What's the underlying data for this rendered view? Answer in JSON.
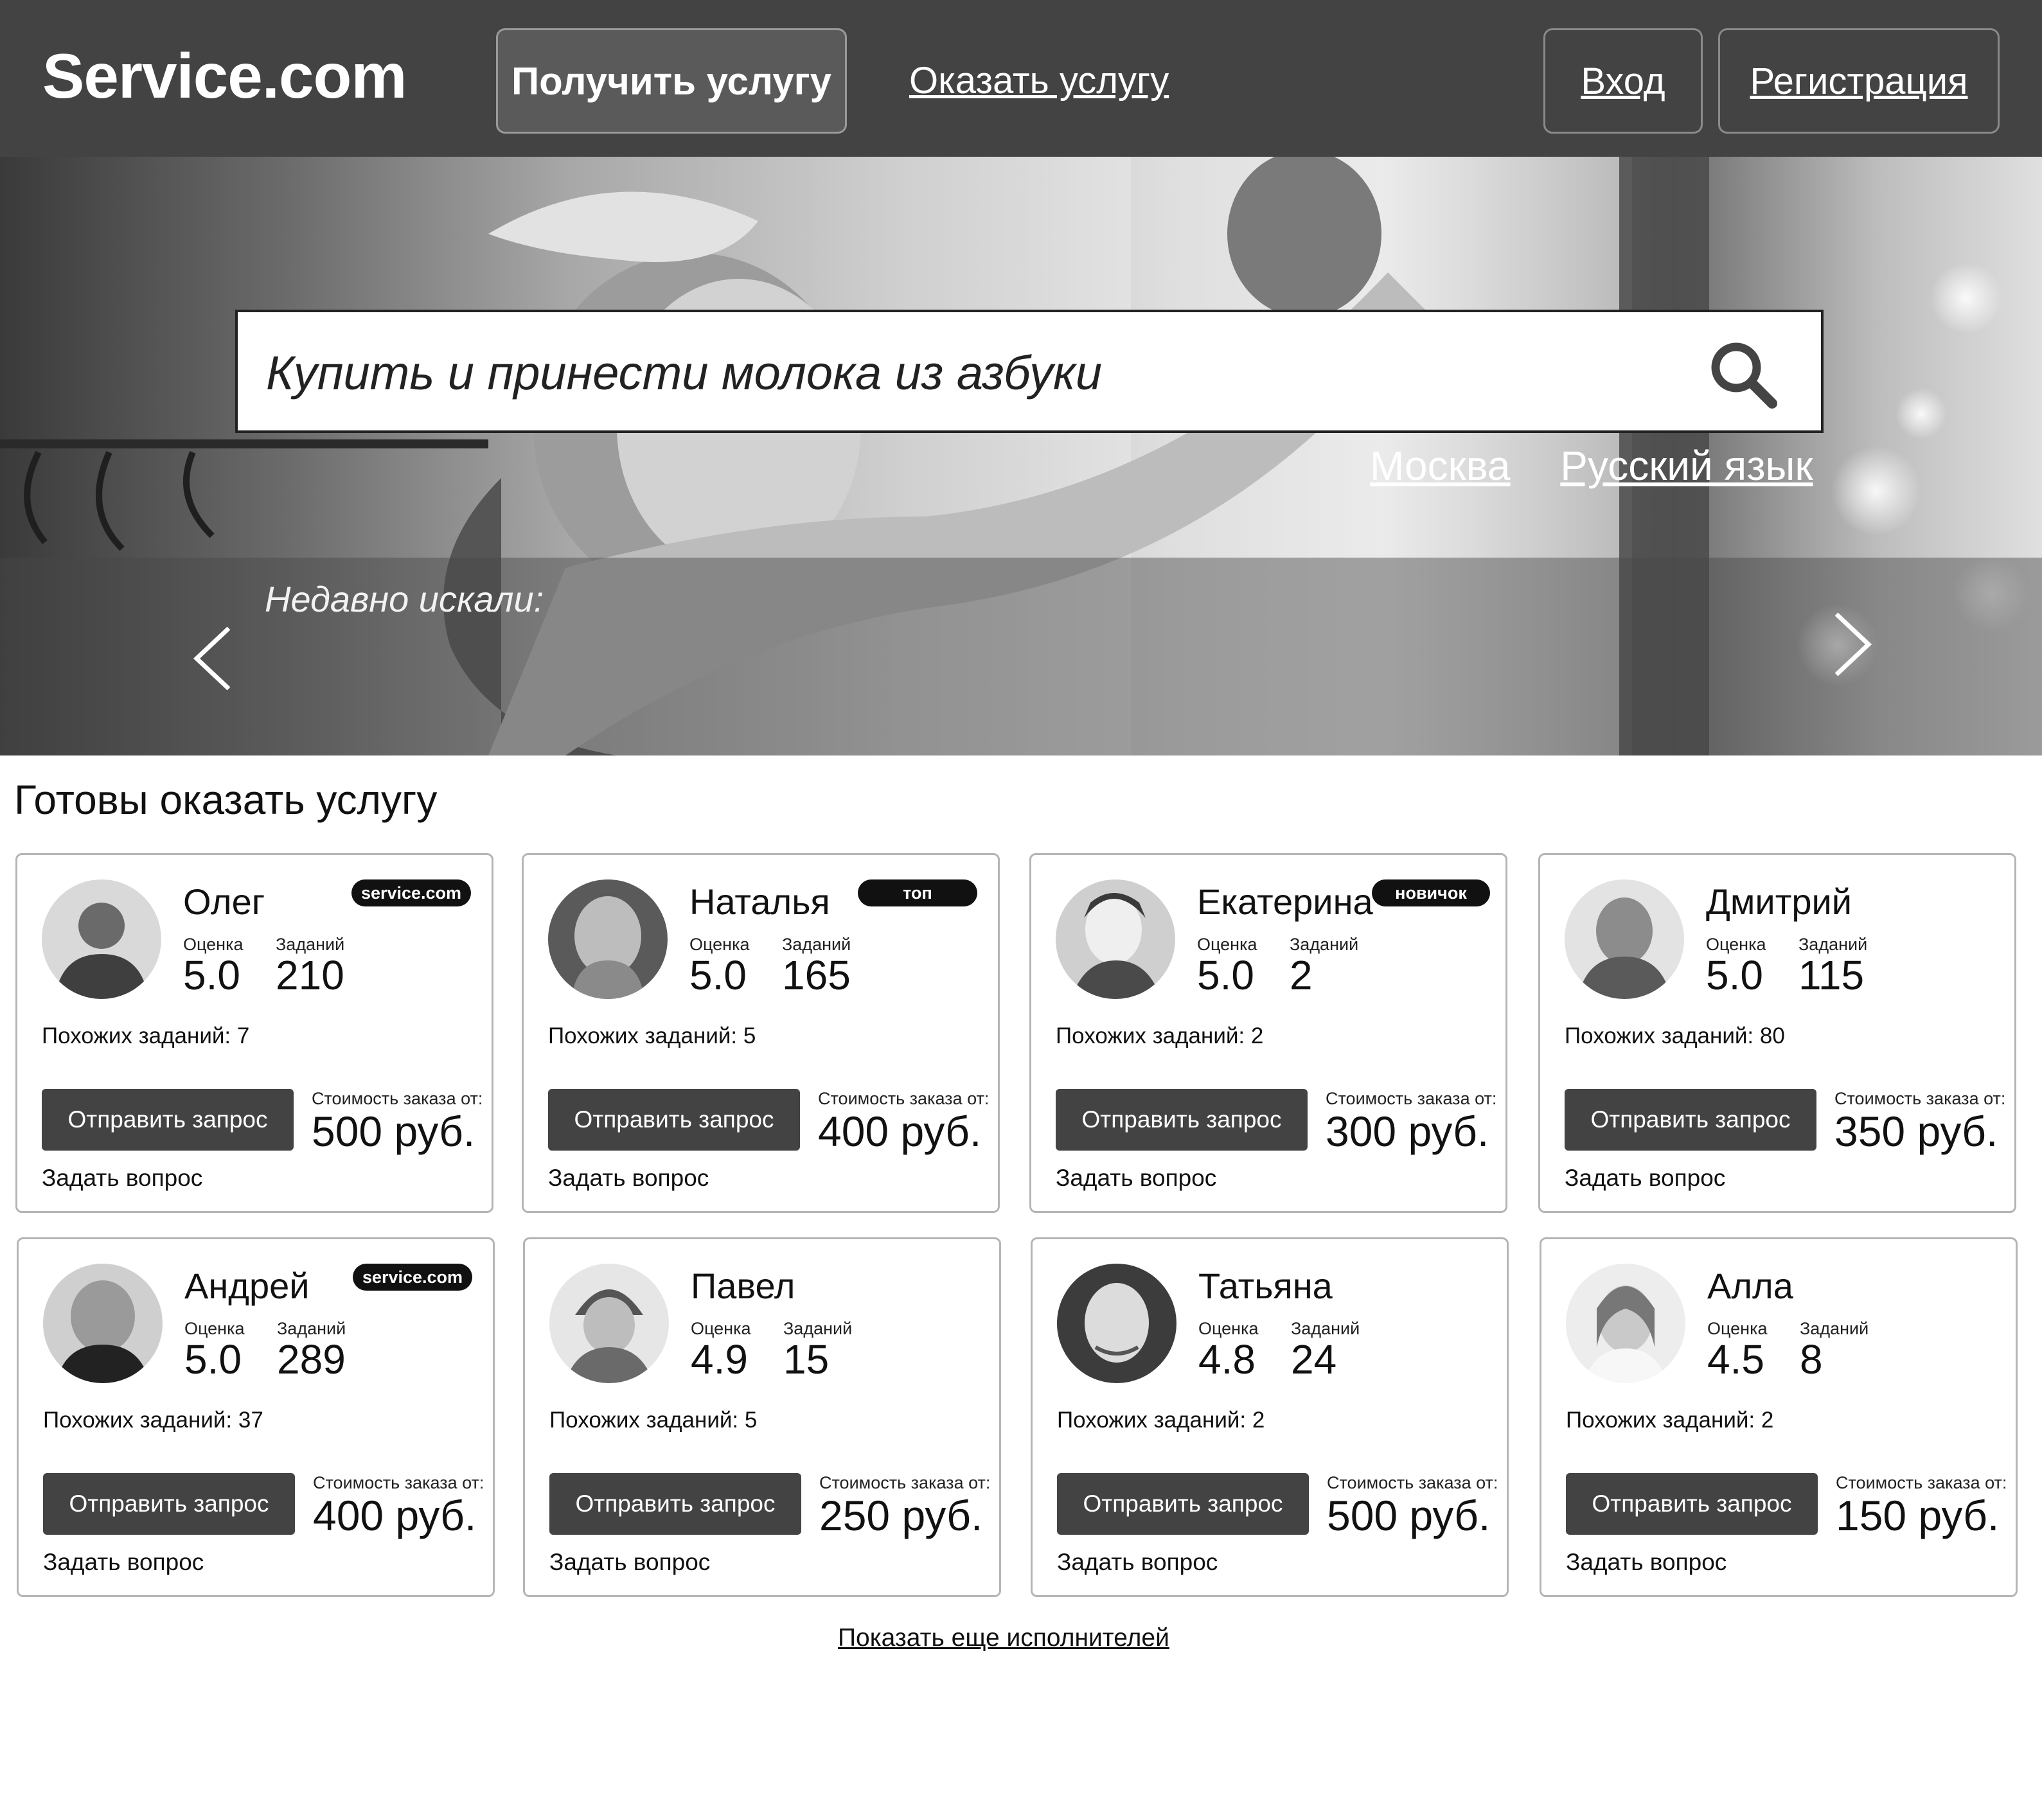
{
  "header": {
    "logo": "Service.com",
    "get_service": "Получить услугу",
    "offer_service": "Оказать услугу",
    "login": "Вход",
    "register": "Регистрация"
  },
  "hero": {
    "search_value": "Купить и принести молока из азбуки",
    "city": "Москва",
    "language": "Русский язык",
    "recent_label": "Недавно искали:"
  },
  "section": {
    "title": "Готовы оказать услугу",
    "rating_label": "Оценка",
    "tasks_label": "Заданий",
    "send_label": "Отправить запрос",
    "cost_label": "Стоимость заказа от:",
    "ask_label": "Задать вопрос",
    "more_link": "Показать еще исполнителей"
  },
  "providers": [
    {
      "name": "Олег",
      "badge": "service.com",
      "rating": "5.0",
      "tasks": "210",
      "similar": "Похожих заданий: 7",
      "price": "500 руб."
    },
    {
      "name": "Наталья",
      "badge": "топ",
      "rating": "5.0",
      "tasks": "165",
      "similar": "Похожих заданий: 5",
      "price": "400 руб."
    },
    {
      "name": "Екатерина",
      "badge": "новичок",
      "rating": "5.0",
      "tasks": "2",
      "similar": "Похожих заданий: 2",
      "price": "300 руб."
    },
    {
      "name": "Дмитрий",
      "badge": "",
      "rating": "5.0",
      "tasks": "115",
      "similar": "Похожих заданий: 80",
      "price": "350 руб."
    },
    {
      "name": "Андрей",
      "badge": "service.com",
      "rating": "5.0",
      "tasks": "289",
      "similar": "Похожих заданий: 37",
      "price": "400 руб."
    },
    {
      "name": "Павел",
      "badge": "",
      "rating": "4.9",
      "tasks": "15",
      "similar": "Похожих заданий: 5",
      "price": "250 руб."
    },
    {
      "name": "Татьяна",
      "badge": "",
      "rating": "4.8",
      "tasks": "24",
      "similar": "Похожих заданий: 2",
      "price": "500 руб."
    },
    {
      "name": "Алла",
      "badge": "",
      "rating": "4.5",
      "tasks": "8",
      "similar": "Похожих заданий: 2",
      "price": "150 руб."
    }
  ]
}
